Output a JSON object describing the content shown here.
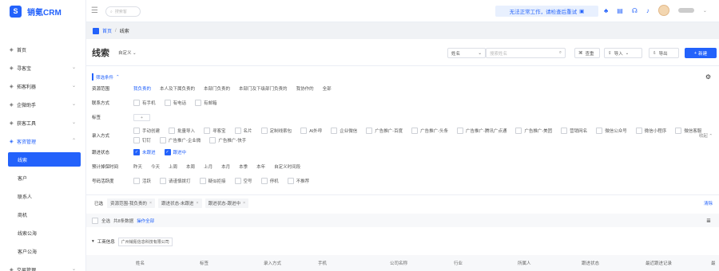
{
  "app": {
    "name": "销氪CRM",
    "logo_letter": "S",
    "brand_color": "#2362fb"
  },
  "sidebar": {
    "items": [
      {
        "label": "首页",
        "icon": "home-icon",
        "expandable": false
      },
      {
        "label": "寻客宝",
        "icon": "compass-icon",
        "expandable": true
      },
      {
        "label": "拓客利器",
        "icon": "toolbox-icon",
        "expandable": true
      },
      {
        "label": "企微助手",
        "icon": "wecom-icon",
        "expandable": true
      },
      {
        "label": "获客工具",
        "icon": "grid-icon",
        "expandable": true
      },
      {
        "label": "客资管理",
        "icon": "folder-icon",
        "expandable": true,
        "open": true
      }
    ],
    "sub_items": [
      {
        "label": "线索",
        "active": true
      },
      {
        "label": "客户"
      },
      {
        "label": "联系人"
      },
      {
        "label": "商机"
      },
      {
        "label": "线索公海"
      },
      {
        "label": "客户公海"
      }
    ],
    "bottom_item": {
      "label": "交易管理",
      "icon": "deal-icon"
    }
  },
  "topbar": {
    "search_placeholder": "搜索客",
    "notice": "无法正常工作，请检查后重试"
  },
  "breadcrumb": {
    "home": "首页",
    "sep": "/",
    "current": "线索"
  },
  "header": {
    "title": "线索",
    "view": "自定义",
    "field_select": "姓名",
    "field_placeholder": "搜索姓名",
    "dedupe": "查重",
    "import": "导入",
    "export": "导出",
    "create": "新建"
  },
  "filters": {
    "title": "筛选条件",
    "rows": [
      {
        "label": "资源范围",
        "options": [
          "我负责的",
          "本人及下属负责的",
          "本部门负责的",
          "本部门及下级部门负责的",
          "我协作的",
          "全部"
        ],
        "selected": 0,
        "kind": "text"
      },
      {
        "label": "联系方式",
        "options": [
          "有手机",
          "有电话",
          "有邮箱"
        ],
        "kind": "checkbox"
      },
      {
        "label": "标签",
        "kind": "tag",
        "add": "+"
      },
      {
        "label": "录入方式",
        "options": [
          "手动创建",
          "批量导入",
          "寻客宝",
          "名片",
          "定制线索包",
          "AI外呼",
          "企业微信",
          "广告推广-百度",
          "广告推广-头条",
          "广告推广-腾讯广点通",
          "广告推广-美团",
          "营销网名",
          "微信公众号",
          "微信小程序",
          "微信客服",
          "钉钉",
          "广告推广-企业微",
          "广告推广-快手"
        ],
        "kind": "checkbox",
        "collapse": "收起"
      },
      {
        "label": "跟进状态",
        "options": [
          "未跟进",
          "跟进中"
        ],
        "checked": [
          0,
          1
        ],
        "kind": "checkbox"
      },
      {
        "label": "预计掉保时间",
        "options": [
          "昨天",
          "今天",
          "上周",
          "本周",
          "上月",
          "本月",
          "本季",
          "本年",
          "自定义时间段"
        ],
        "kind": "text"
      },
      {
        "label": "号码活跃度",
        "options": [
          "活跃",
          "请谨慎拨打",
          "疑似拒接",
          "空号",
          "停机",
          "不推荐"
        ],
        "kind": "checkbox"
      }
    ]
  },
  "chosen": {
    "label": "已选",
    "chips": [
      "资源范围-我负责的",
      "跟进状态-未跟进",
      "跟进状态-跟进中"
    ],
    "clear": "清除"
  },
  "selection": {
    "all": "全选",
    "count": "共8条数据",
    "action": "操作全部"
  },
  "biz_info": {
    "label": "工商信息",
    "company": "广州销氪信息科技有限公司"
  },
  "table": {
    "columns": [
      "姓名",
      "标签",
      "录入方式",
      "手机",
      "公司名称",
      "行业",
      "所属人",
      "跟进状态",
      "最近跟进记录",
      "最"
    ]
  }
}
